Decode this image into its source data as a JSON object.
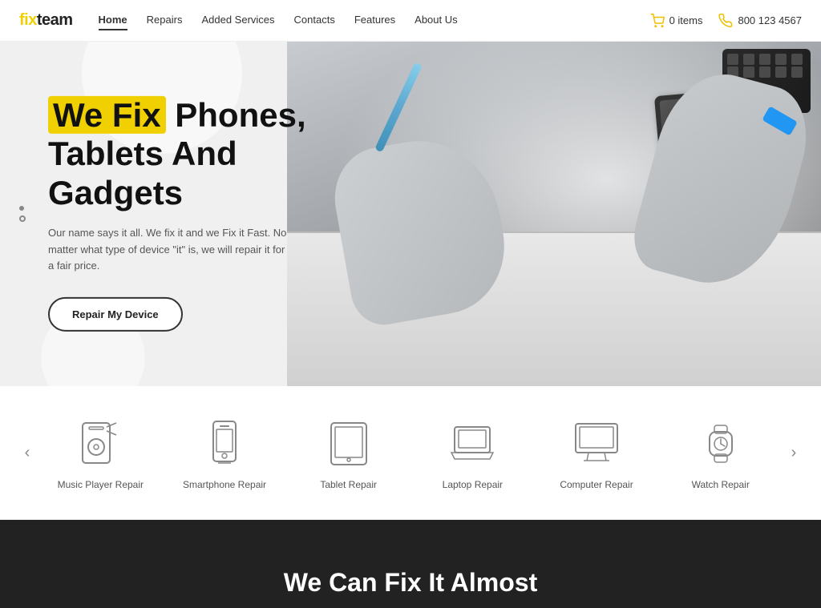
{
  "brand": {
    "fix": "fix",
    "team": "team",
    "full": "fixteam"
  },
  "navbar": {
    "links": [
      {
        "label": "Home",
        "active": true
      },
      {
        "label": "Repairs",
        "active": false
      },
      {
        "label": "Added Services",
        "active": false
      },
      {
        "label": "Contacts",
        "active": false
      },
      {
        "label": "Features",
        "active": false
      },
      {
        "label": "About Us",
        "active": false
      }
    ],
    "cart_label": "0 items",
    "phone": "800 123 4567"
  },
  "hero": {
    "title_part1": "We Fix",
    "title_part2": " Phones,",
    "title_line2": "Tablets And",
    "title_line3": "Gadgets",
    "subtitle": "Our name says it all. We fix it and we Fix it Fast. No matter what type of device \"it\" is, we will repair it for a fair price.",
    "cta_label": "Repair My Device"
  },
  "services": {
    "prev_label": "‹",
    "next_label": "›",
    "items": [
      {
        "id": "music-player",
        "label": "Music Player Repair"
      },
      {
        "id": "smartphone",
        "label": "Smartphone Repair"
      },
      {
        "id": "tablet",
        "label": "Tablet Repair"
      },
      {
        "id": "laptop",
        "label": "Laptop Repair"
      },
      {
        "id": "computer",
        "label": "Computer Repair"
      },
      {
        "id": "watch",
        "label": "Watch Repair"
      }
    ]
  },
  "dark_section": {
    "title": "We Can Fix It Almost"
  },
  "colors": {
    "accent": "#f0d000",
    "dark": "#222222",
    "nav_bg": "#ffffff"
  }
}
